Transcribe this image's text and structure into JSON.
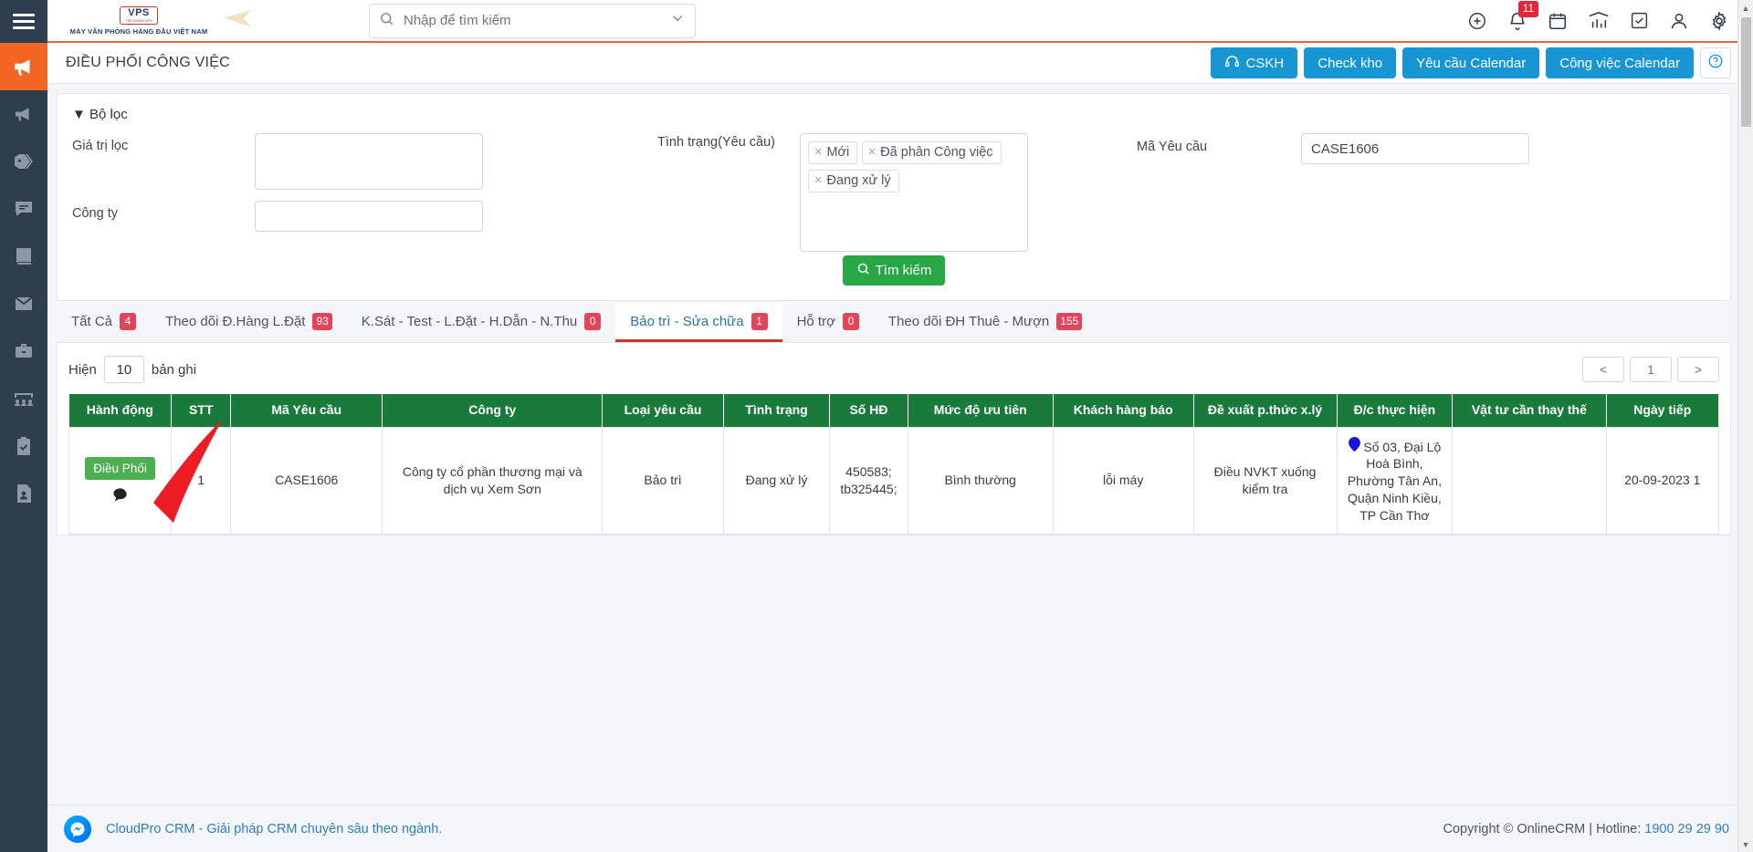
{
  "sidebar": {
    "menu_icon": "hamburger-icon",
    "items": [
      {
        "name": "megaphone-active",
        "icon": "megaphone-icon",
        "active": true
      },
      {
        "name": "campaign",
        "icon": "megaphone-icon",
        "active": false
      },
      {
        "name": "tags",
        "icon": "tag-icon",
        "active": false
      },
      {
        "name": "messages",
        "icon": "chat-icon",
        "active": false
      },
      {
        "name": "catalog",
        "icon": "book-icon",
        "active": false
      },
      {
        "name": "mail",
        "icon": "envelope-icon",
        "active": false
      },
      {
        "name": "briefcase",
        "icon": "briefcase-icon",
        "active": false
      },
      {
        "name": "meeting",
        "icon": "users-icon",
        "active": false
      },
      {
        "name": "tasks",
        "icon": "clipboard-check-icon",
        "active": false
      },
      {
        "name": "contacts",
        "icon": "contact-card-icon",
        "active": false
      }
    ]
  },
  "topbar": {
    "logo": {
      "brand": "VPS",
      "brand_sub": "TẬP ĐOÀN VPS",
      "tagline": "MÁY VĂN PHÒNG HÀNG ĐẦU VIỆT NAM"
    },
    "search": {
      "placeholder": "Nhập để tìm kiếm",
      "value": "",
      "icon": "search-icon",
      "caret": "chevron-down-icon"
    },
    "icons": [
      {
        "name": "add-icon",
        "glyph": "plus-circle"
      },
      {
        "name": "bell-icon",
        "glyph": "bell",
        "badge": "11"
      },
      {
        "name": "calendar-icon",
        "glyph": "calendar"
      },
      {
        "name": "chart-icon",
        "glyph": "chart"
      },
      {
        "name": "task-icon",
        "glyph": "check-square"
      },
      {
        "name": "user-icon",
        "glyph": "user"
      },
      {
        "name": "settings-icon",
        "glyph": "gear"
      }
    ]
  },
  "pagehead": {
    "title": "ĐIỀU PHỐI CÔNG VIỆC",
    "buttons": [
      {
        "label": "CSKH",
        "icon": "headset-icon"
      },
      {
        "label": "Check kho",
        "icon": ""
      },
      {
        "label": "Yêu cầu Calendar",
        "icon": ""
      },
      {
        "label": "Công việc Calendar",
        "icon": ""
      }
    ],
    "help_label": "?"
  },
  "filter": {
    "title": "Bộ lọc",
    "collapse_icon": "triangle-down-icon",
    "gia_tri_loc_label": "Giá trị lọc",
    "gia_tri_loc_value": "",
    "cong_ty_label": "Công ty",
    "cong_ty_value": "",
    "tinh_trang_label": "Tình trạng(Yêu cầu)",
    "tinh_trang_tags": [
      "Mới",
      "Đã phân Công việc",
      "Đang xử lý"
    ],
    "ma_yeu_cau_label": "Mã Yêu cầu",
    "ma_yeu_cau_value": "CASE1606",
    "search_button": "Tìm kiếm",
    "search_icon": "search-icon"
  },
  "tabs": [
    {
      "label": "Tất Cả",
      "count": "4",
      "active": false
    },
    {
      "label": "Theo dõi Đ.Hàng L.Đặt",
      "count": "93",
      "active": false
    },
    {
      "label": "K.Sát - Test - L.Đặt - H.Dẫn - N.Thu",
      "count": "0",
      "active": false
    },
    {
      "label": "Bảo trì - Sửa chữa",
      "count": "1",
      "active": true
    },
    {
      "label": "Hỗ trợ",
      "count": "0",
      "active": false
    },
    {
      "label": "Theo dõi ĐH Thuê - Mượn",
      "count": "155",
      "active": false
    }
  ],
  "table_controls": {
    "show_prefix": "Hiện",
    "show_value": "10",
    "show_suffix": "bản ghi",
    "pager": {
      "prev": "<",
      "current": "1",
      "next": ">"
    }
  },
  "table": {
    "columns": [
      "Hành động",
      "STT",
      "Mã Yêu cầu",
      "Công ty",
      "Loại yêu cầu",
      "Tình trạng",
      "Số HĐ",
      "Mức độ ưu tiên",
      "Khách hàng báo",
      "Đề xuất p.thức x.lý",
      "Đ/c thực hiện",
      "Vật tư cần thay thế",
      "Ngày tiếp"
    ],
    "rows": [
      {
        "action_label": "Điều Phối",
        "action_icon": "comment-icon",
        "stt": "1",
        "ma_yeu_cau": "CASE1606",
        "cong_ty": "Công ty cổ phần thương mại và dịch vụ Xem Sơn",
        "loai_yeu_cau": "Bảo trì",
        "tinh_trang": "Đang xử lý",
        "so_hd": "450583; tb325445;",
        "muc_do_uu_tien": "Bình thường",
        "khach_hang_bao": "lỗi máy",
        "de_xuat": "Điều NVKT xuống kiểm tra",
        "dia_chi": "Số 03, Đại Lộ Hoà Bình, Phường Tân An, Quận Ninh Kiều, TP Cần Thơ",
        "dia_chi_icon": "map-pin-icon",
        "vat_tu": "",
        "ngay_tiep": "20-09-2023 1"
      }
    ]
  },
  "footer": {
    "messenger_icon": "messenger-icon",
    "left_text": "CloudPro CRM - Giải pháp CRM chuyên sâu theo ngành.",
    "copyright": "Copyright © OnlineCRM | Hotline: ",
    "hotline": "1900 29 29 90"
  },
  "annotation": {
    "name": "red-arrow-pointer",
    "color": "#ee1c25"
  }
}
